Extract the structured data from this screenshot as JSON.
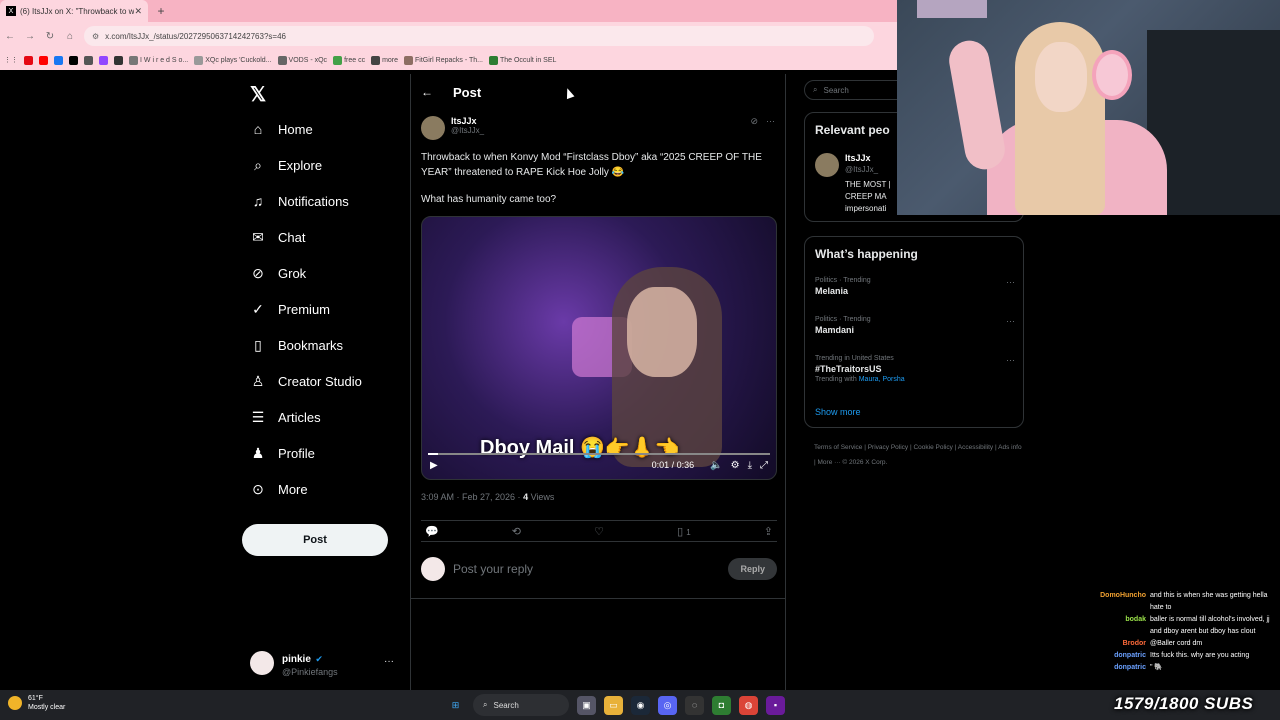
{
  "browser": {
    "tab_title": "(6) ItsJJx on X: \"Throwback to w...",
    "url": "x.com/ItsJJx_/status/2027295063714242763?s=46",
    "bookmarks": [
      "I W i r e d  S o...",
      "XQc plays 'Cuckold...",
      "VODS - xQc",
      "free cc",
      "more",
      "FitGirl Repacks - Th...",
      "The Occult in SEL"
    ]
  },
  "nav": {
    "items": [
      "Home",
      "Explore",
      "Notifications",
      "Chat",
      "Grok",
      "Premium",
      "Bookmarks",
      "Creator Studio",
      "Articles",
      "Profile",
      "More"
    ],
    "post_button": "Post",
    "account": {
      "name": "pinkie",
      "handle": "@Pinkiefangs"
    }
  },
  "post": {
    "header": "Post",
    "author_name": "ItsJJx",
    "author_handle": "@ItsJJx_",
    "text": "Throwback to when Konvy Mod “Firstclass Dboy” aka “2025 CREEP OF THE YEAR” threatened to RAPE Kick Hoe Jolly 😂",
    "text2": "What has humanity came too?",
    "video_caption": "Dboy Mail 😭👉👃👈",
    "video_time": "0:01 / 0:36",
    "video_progress": 0.03,
    "timestamp": "3:09 AM · Feb 27, 2026 · ",
    "views_count": "4",
    "views_label": " Views",
    "bookmark_count": "1",
    "reply_placeholder": "Post your reply",
    "reply_button": "Reply"
  },
  "right": {
    "search_placeholder": "Search",
    "relevant_title": "Relevant peo",
    "relevant_name": "ItsJJx",
    "relevant_handle": "@ItsJJx_",
    "relevant_bio": "THE MOST | CREEP MA impersonati",
    "happening_title": "What’s happening",
    "trends": [
      {
        "context": "Politics · Trending",
        "name": "Melania"
      },
      {
        "context": "Politics · Trending",
        "name": "Mamdani"
      },
      {
        "context": "Trending in United States",
        "name": "#TheTraitorsUS",
        "with_label": "Trending with ",
        "with_names": "Maura, Porsha"
      }
    ],
    "show_more": "Show more",
    "footer": "Terms of Service  |  Privacy Policy  |  Cookie Policy  |  Accessibility  |  Ads info  |  More ···  © 2026 X Corp."
  },
  "chat": [
    {
      "user": "DomoHuncho",
      "color": "#f0a030",
      "msg": "and this is when she was getting hella hate to"
    },
    {
      "user": "bodak",
      "color": "#9be34a",
      "msg": "baller is normal till alcohol's involved, jj and dboy arent but dboy has clout"
    },
    {
      "user": "Brodor",
      "color": "#ff6a3a",
      "msg": "@Baller cord dm"
    },
    {
      "user": "donpatric",
      "color": "#6aa0ff",
      "msg": "Itts fuck this. why are you acting"
    },
    {
      "user": "donpatric",
      "color": "#6aa0ff",
      "msg": "\" 🐘"
    }
  ],
  "taskbar": {
    "temp": "61°F",
    "weather": "Mostly clear",
    "search": "Search"
  },
  "overlay": {
    "subs": "1579/1800 SUBS"
  },
  "colors": {
    "accent": "#1d9bf0",
    "tab_pink": "#f7b3c3",
    "bg": "#000000"
  }
}
